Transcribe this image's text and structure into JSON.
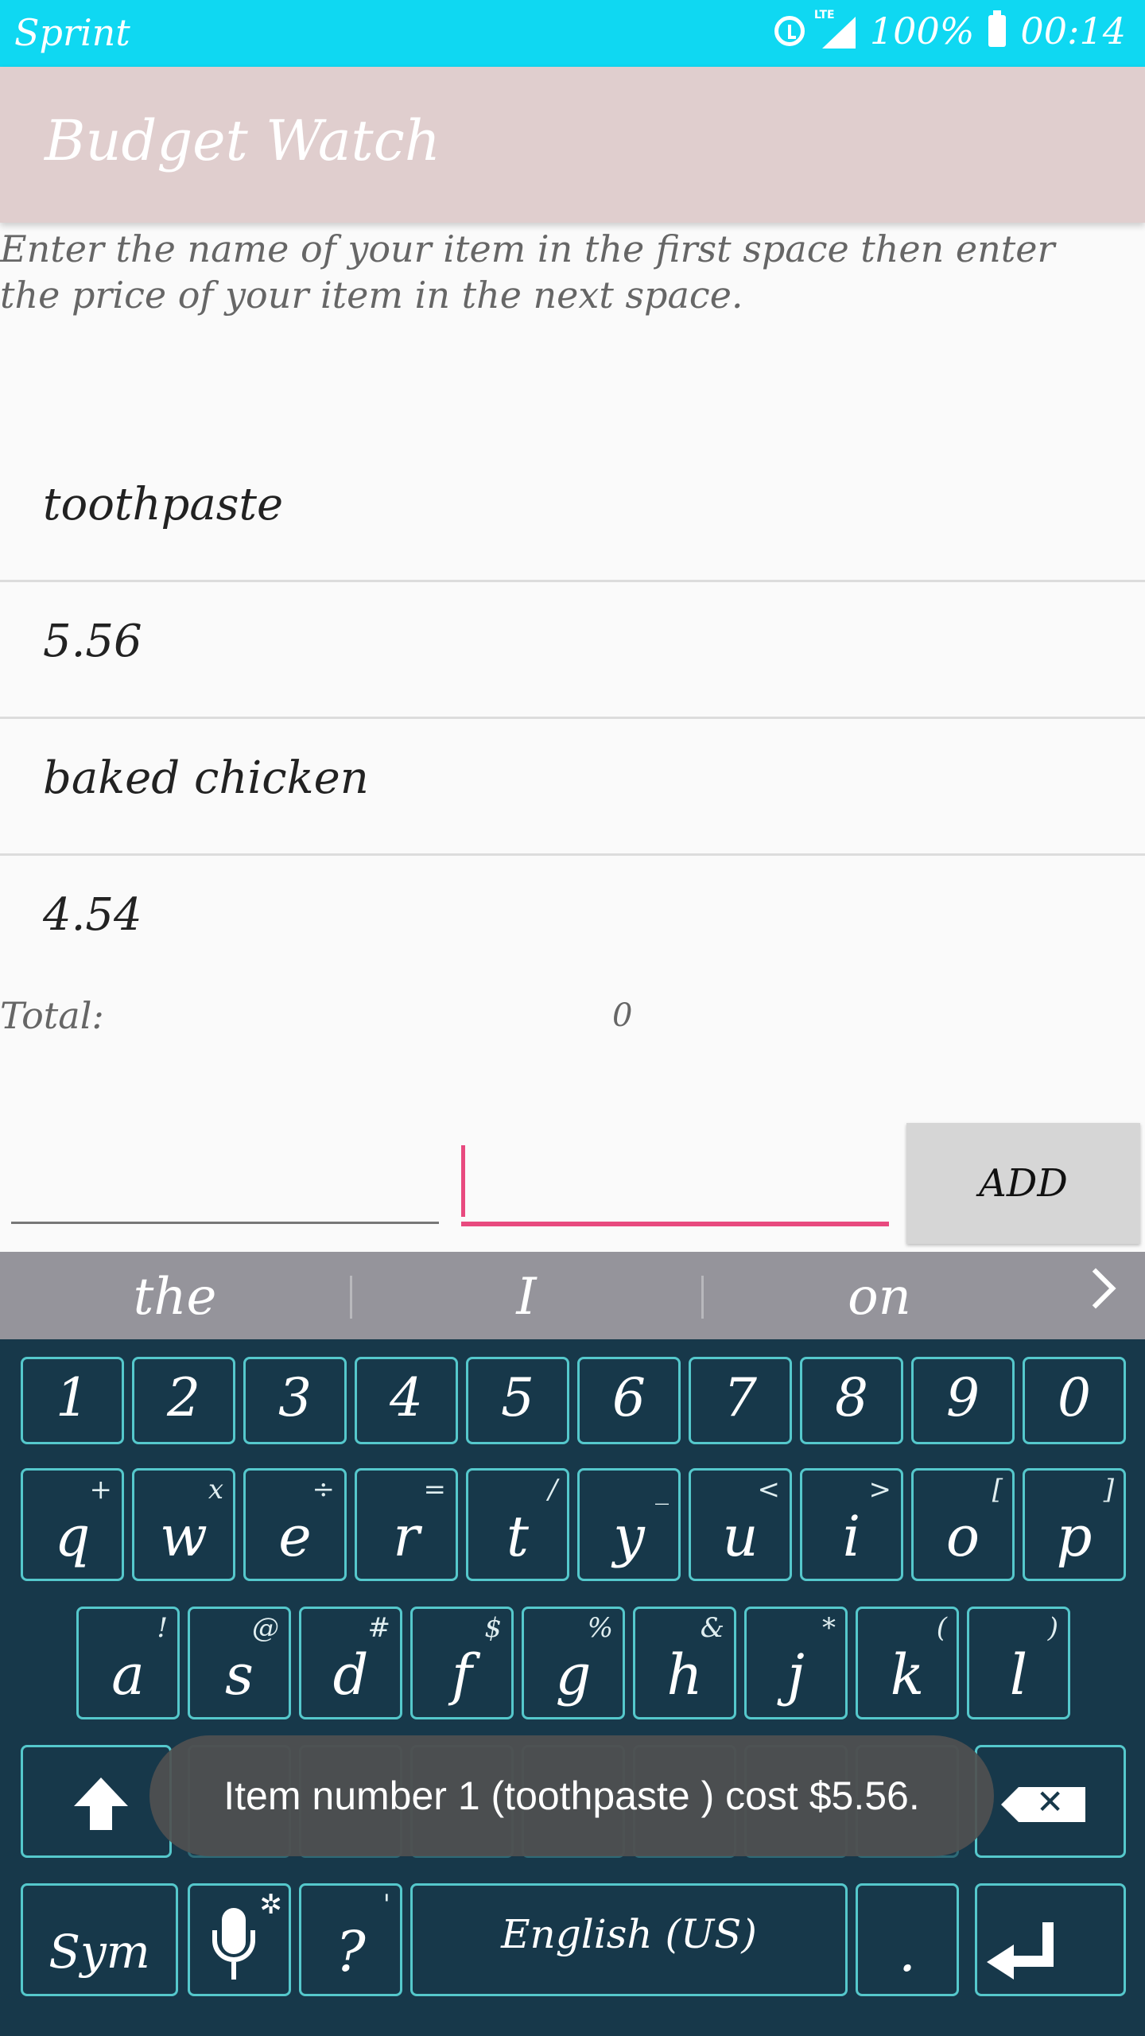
{
  "status_bar": {
    "carrier": "Sprint",
    "network": "LTE",
    "battery": "100%",
    "time": "00:14"
  },
  "app_bar": {
    "title": "Budget Watch"
  },
  "instructions": "Enter the name of your item in the first space then enter the price of your item in the next space.",
  "items": [
    {
      "name": "toothpaste",
      "price": "5.56"
    },
    {
      "name": "baked chicken",
      "price": "4.54"
    }
  ],
  "total": {
    "label": "Total:",
    "value": "0"
  },
  "add_button": "ADD",
  "suggestions": [
    "the",
    "I",
    "on"
  ],
  "keyboard": {
    "num_row": [
      "1",
      "2",
      "3",
      "4",
      "5",
      "6",
      "7",
      "8",
      "9",
      "0"
    ],
    "row1": [
      {
        "k": "q",
        "s": "+"
      },
      {
        "k": "w",
        "s": "x"
      },
      {
        "k": "e",
        "s": "÷"
      },
      {
        "k": "r",
        "s": "="
      },
      {
        "k": "t",
        "s": "/"
      },
      {
        "k": "y",
        "s": "_"
      },
      {
        "k": "u",
        "s": "<"
      },
      {
        "k": "i",
        "s": ">"
      },
      {
        "k": "o",
        "s": "["
      },
      {
        "k": "p",
        "s": "]"
      }
    ],
    "row2": [
      {
        "k": "a",
        "s": "!"
      },
      {
        "k": "s",
        "s": "@"
      },
      {
        "k": "d",
        "s": "#"
      },
      {
        "k": "f",
        "s": "$"
      },
      {
        "k": "g",
        "s": "%"
      },
      {
        "k": "h",
        "s": "&"
      },
      {
        "k": "j",
        "s": "*"
      },
      {
        "k": "k",
        "s": "("
      },
      {
        "k": "l",
        "s": ")"
      }
    ],
    "sym_label": "Sym",
    "question_key": "?",
    "question_sub": "'",
    "space_label": "English (US)",
    "period_key": "."
  },
  "toast": "Item number 1 (toothpaste ) cost $5.56."
}
